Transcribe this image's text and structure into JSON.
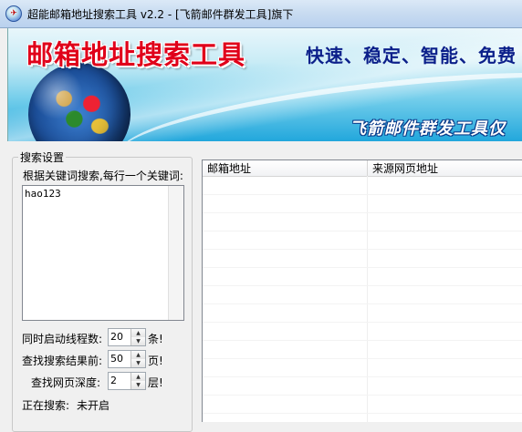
{
  "window": {
    "title": "超能邮箱地址搜索工具 v2.2 - [飞箭邮件群发工具]旗下",
    "icon_name": "app-icon"
  },
  "banner": {
    "title": "邮箱地址搜索工具",
    "slogan": "快速、稳定、智能、免费",
    "subtitle": "飞箭邮件群发工具仅"
  },
  "search_settings": {
    "legend": "搜索设置",
    "keyword_label": "根据关键词搜索,每行一个关键词:",
    "keywords": "hao123",
    "threads": {
      "label": "同时启动线程数:",
      "value": "20",
      "unit": "条!"
    },
    "results": {
      "label": "查找搜索结果前:",
      "value": "50",
      "unit": "页!"
    },
    "depth": {
      "label": "查找网页深度:",
      "value": "2",
      "unit": "层!"
    },
    "status": {
      "label": "正在搜索:",
      "value": "未开启"
    }
  },
  "results_list": {
    "columns": [
      "邮箱地址",
      "来源网页地址"
    ]
  }
}
